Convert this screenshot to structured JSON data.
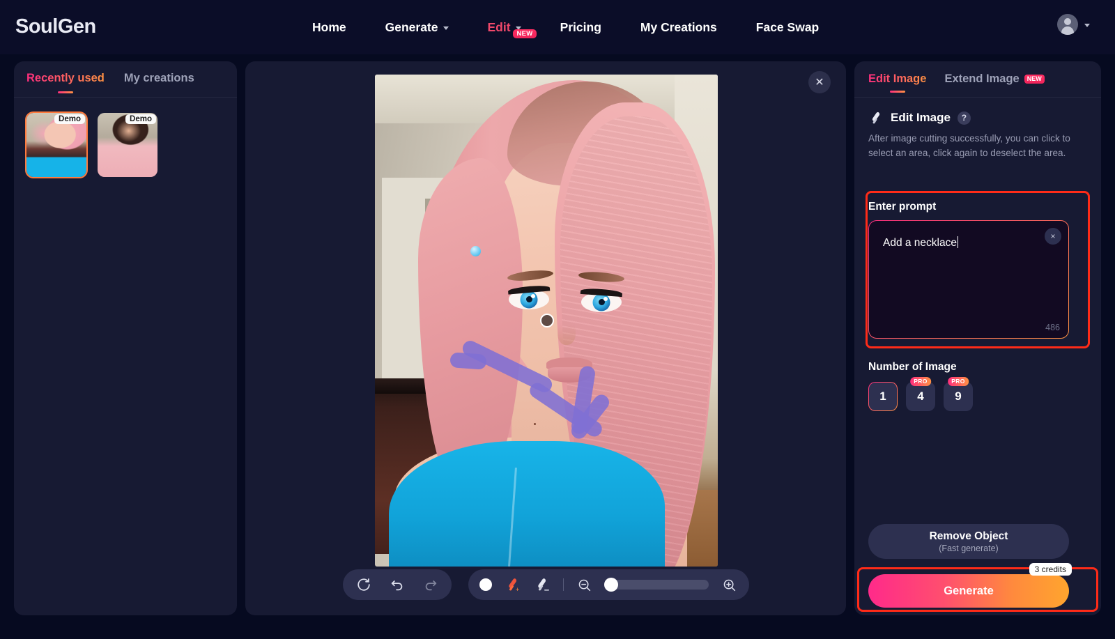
{
  "brand": {
    "name": "SoulGen"
  },
  "nav": {
    "items": [
      {
        "label": "Home",
        "accent": false,
        "caret": false,
        "badge": ""
      },
      {
        "label": "Generate",
        "accent": false,
        "caret": true,
        "badge": ""
      },
      {
        "label": "Edit",
        "accent": true,
        "caret": true,
        "badge": "NEW"
      },
      {
        "label": "Pricing",
        "accent": false,
        "caret": false,
        "badge": ""
      },
      {
        "label": "My Creations",
        "accent": false,
        "caret": false,
        "badge": ""
      },
      {
        "label": "Face Swap",
        "accent": false,
        "caret": false,
        "badge": ""
      }
    ],
    "profile_icon": "user-avatar-icon"
  },
  "sidebar": {
    "tabs": [
      {
        "label": "Recently used",
        "active": true
      },
      {
        "label": "My creations",
        "active": false
      }
    ],
    "thumbnails": [
      {
        "badge": "Demo",
        "selected": true
      },
      {
        "badge": "Demo",
        "selected": false
      }
    ]
  },
  "canvas": {
    "close_icon": "close-icon",
    "toolbar": {
      "history": [
        {
          "icon": "reset-icon",
          "label": "Reset"
        },
        {
          "icon": "undo-icon",
          "label": "Undo"
        },
        {
          "icon": "redo-icon",
          "label": "Redo"
        }
      ],
      "tools": [
        {
          "icon": "brush-size-dot-icon",
          "label": "Brush size"
        },
        {
          "icon": "brush-add-icon",
          "label": "Add to selection"
        },
        {
          "icon": "brush-erase-icon",
          "label": "Erase selection"
        }
      ],
      "zoom_out_icon": "zoom-out-icon",
      "zoom_in_icon": "zoom-in-icon",
      "zoom_value": 0
    }
  },
  "right_panel": {
    "tabs": [
      {
        "label": "Edit Image",
        "active": true,
        "badge": ""
      },
      {
        "label": "Extend Image",
        "active": false,
        "badge": "NEW"
      }
    ],
    "section": {
      "icon": "brush-icon",
      "title": "Edit Image",
      "help_icon": "question-mark-icon",
      "help_label": "?",
      "description": "After image cutting successfully, you can click to select an area, click again to deselect the area."
    },
    "prompt": {
      "label": "Enter prompt",
      "value": "Add a necklace",
      "placeholder": "Enter prompt",
      "clear_icon": "clear-icon",
      "clear_label": "×",
      "char_count": "486"
    },
    "number_of_image": {
      "label": "Number of Image",
      "options": [
        {
          "value": "1",
          "pro": false,
          "selected": true
        },
        {
          "value": "4",
          "pro": true,
          "pro_label": "PRO",
          "selected": false
        },
        {
          "value": "9",
          "pro": true,
          "pro_label": "PRO",
          "selected": false
        }
      ]
    },
    "remove_object": {
      "title": "Remove Object",
      "subtitle": "(Fast generate)"
    },
    "generate": {
      "label": "Generate",
      "credits": "3 credits"
    }
  },
  "colors": {
    "accent_pink": "#ff2e7e",
    "accent_orange": "#ff9243",
    "highlight_red": "#ff2b18",
    "panel_bg": "#171a33",
    "page_bg": "#060a20",
    "mask_purple": "#7f6fd4"
  }
}
